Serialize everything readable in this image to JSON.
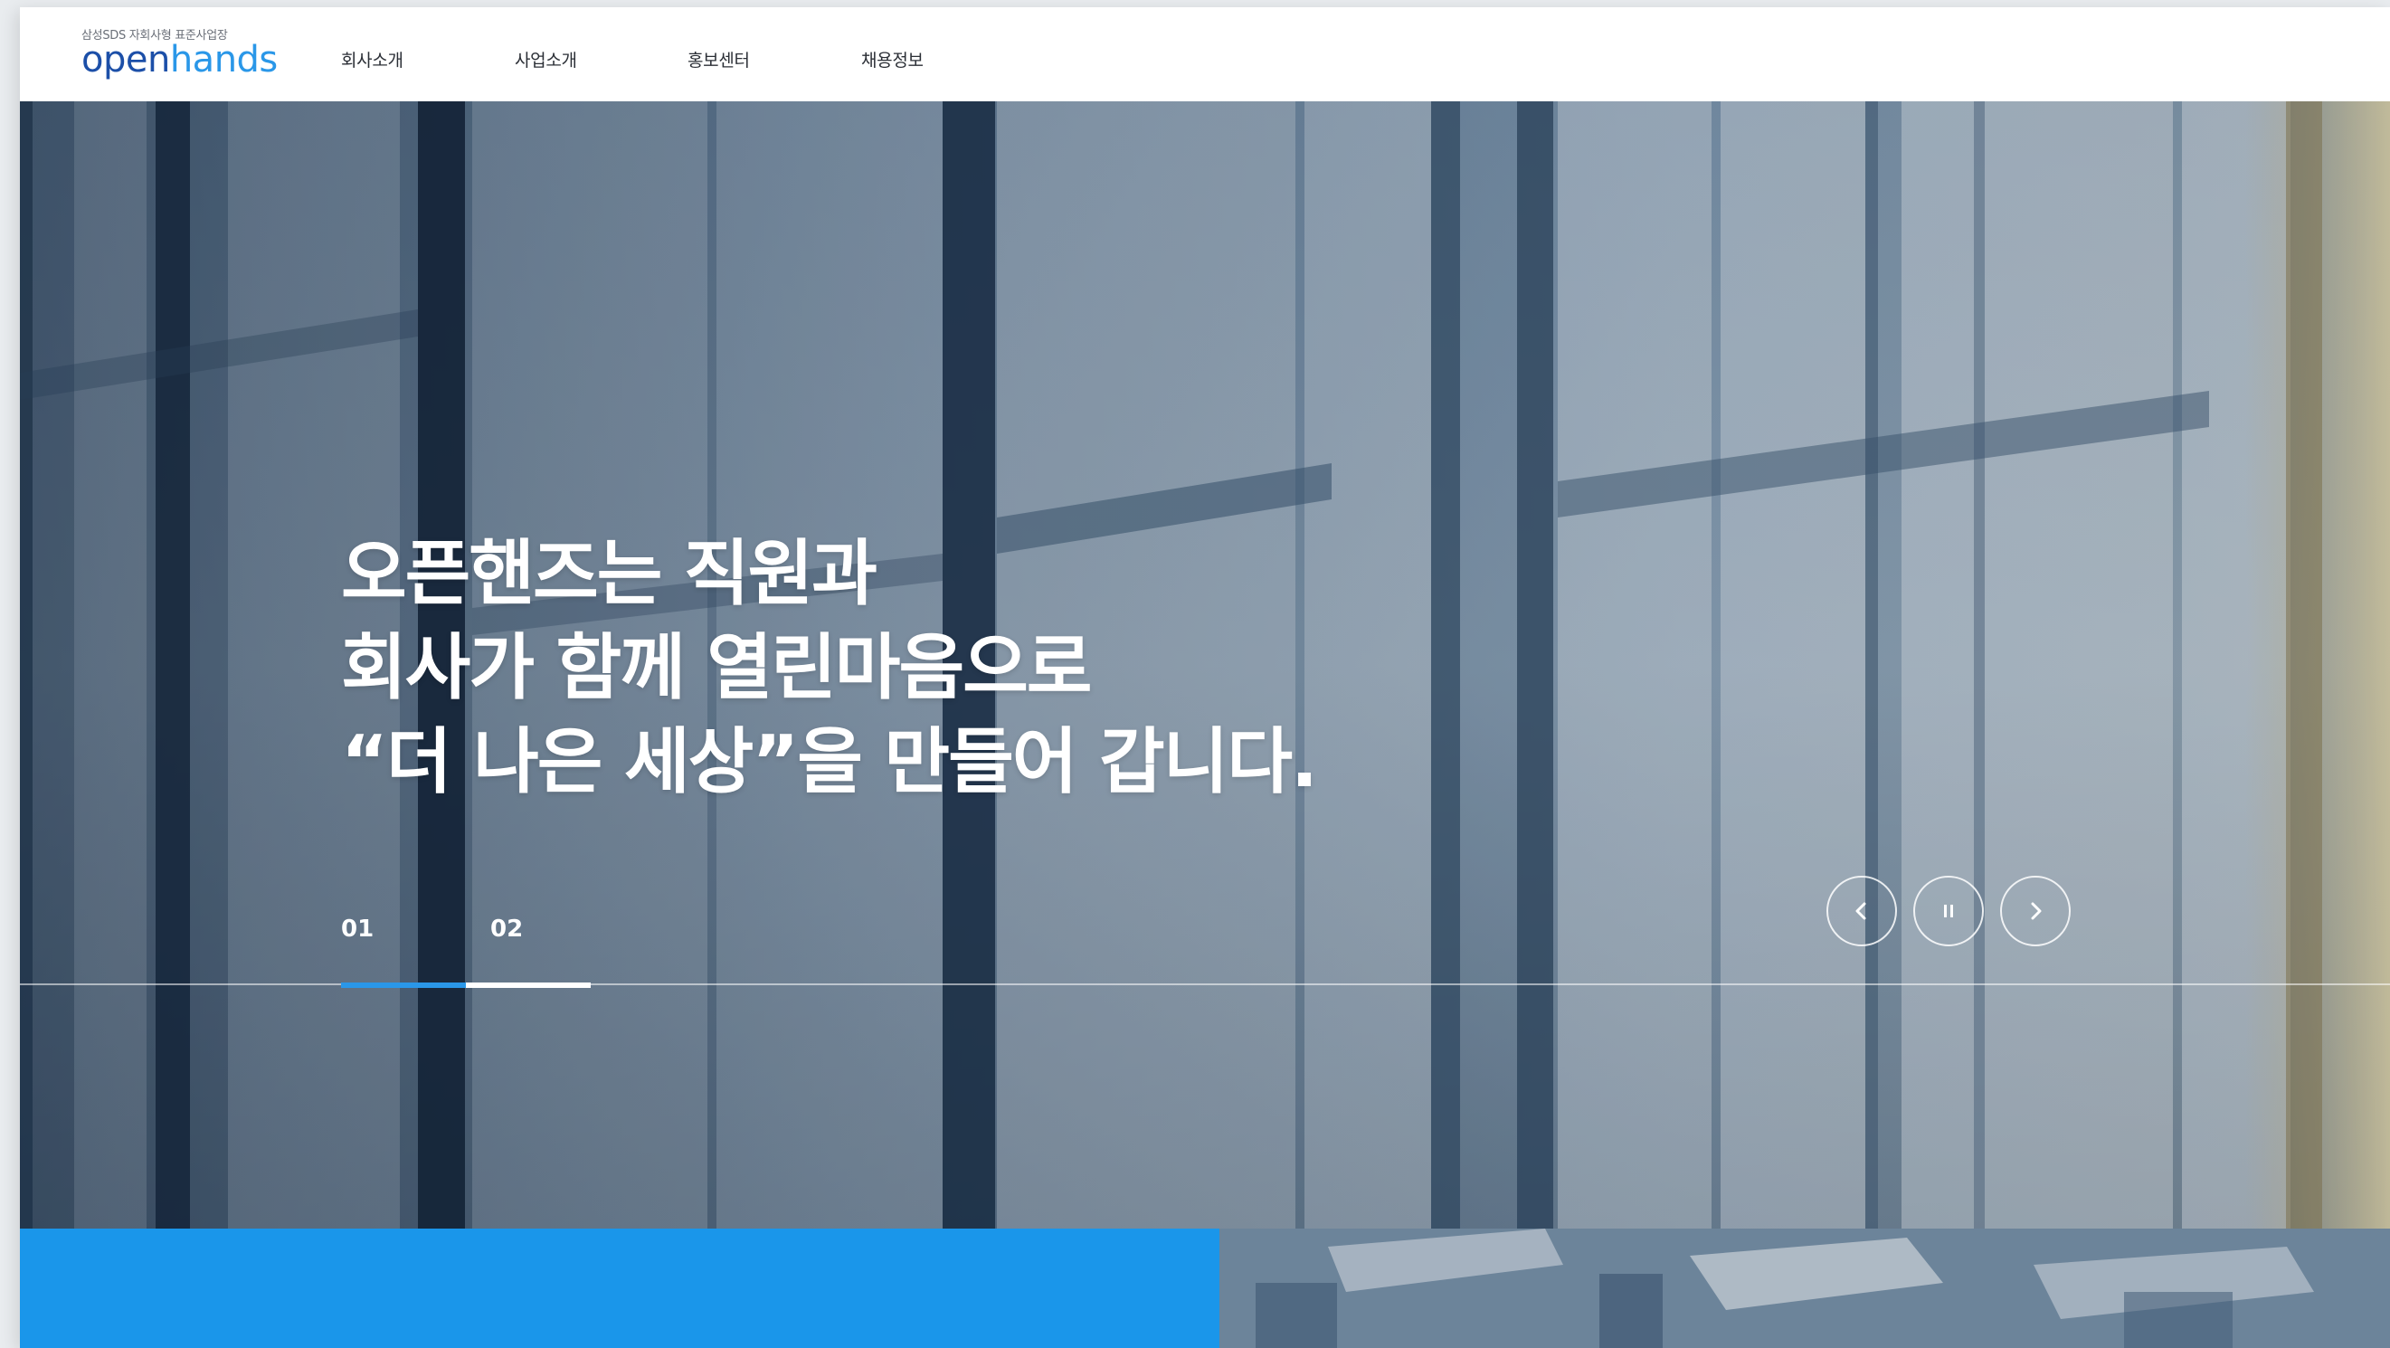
{
  "logo": {
    "tagline": "삼성SDS 자회사형 표준사업장",
    "word_open": "open",
    "word_hands": "hands"
  },
  "nav": {
    "items": [
      {
        "label": "회사소개"
      },
      {
        "label": "사업소개"
      },
      {
        "label": "홍보센터"
      },
      {
        "label": "채용정보"
      }
    ]
  },
  "hero": {
    "lines": [
      "오픈핸즈는 직원과",
      "회사가 함께 열린마음으로",
      "“더 나은 세상”을 만들어 갑니다."
    ],
    "pager": {
      "items": [
        "01",
        "02"
      ],
      "active_index": 0
    },
    "controls": {
      "prev_icon": "chevron-left-icon",
      "pause_icon": "pause-icon",
      "next_icon": "chevron-right-icon"
    }
  },
  "colors": {
    "brand_blue": "#1a96ea",
    "logo_dark": "#1c4fa8",
    "logo_light": "#2a97e8",
    "pager_active": "#2a97e8",
    "pager_inactive": "#ffffff"
  }
}
